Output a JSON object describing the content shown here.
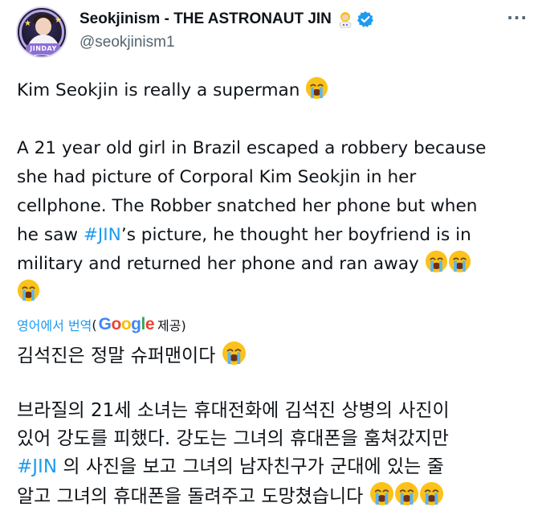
{
  "author": {
    "display_name": "Seokjinism - THE ASTRONAUT JIN",
    "handle": "@seokjinism1",
    "avatar_badge_text": "JINDAY",
    "emoji_after_name": "astronaut-emoji",
    "verified_icon": "verified-badge-icon",
    "verified_color": "#1d9bf0"
  },
  "more_menu_glyph": "···",
  "tweet": {
    "line1": "Kim Seokjin is really a superman",
    "para2_l1": "A 21 year old girl in Brazil escaped a robbery because",
    "para2_l2": "she had picture of Corporal Kim Seokjin in her",
    "para2_l3": "cellphone. The Robber snatched her phone but when",
    "para2_l4_pre": "he saw ",
    "hashtag": "#JIN",
    "para2_l4_post": "’s picture, he thought her boyfriend is in",
    "para2_l5": "military and returned her phone and ran away",
    "emoji": "loudly-crying-face-emoji"
  },
  "translation": {
    "label": "영어에서 번역",
    "open_paren": "(",
    "google_letters": [
      "G",
      "o",
      "o",
      "g",
      "l",
      "e"
    ],
    "google_colors": [
      "#4285F4",
      "#EA4335",
      "#FBBC05",
      "#4285F4",
      "#34A853",
      "#EA4335"
    ],
    "provided": " 제공)"
  },
  "korean": {
    "line1": "김석진은 정말 슈퍼맨이다",
    "p2_l1": "브라질의 21세 소녀는 휴대전화에 김석진 상병의 사진이",
    "p2_l2": "있어 강도를 피했다. 강도는 그녀의 휴대폰을 훔쳐갔지만",
    "hashtag": "#JIN",
    "p2_l3_post": " 의 사진을 보고 그녀의 남자친구가 군대에 있는 줄",
    "p2_l4": "알고 그녀의 휴대폰을 돌려주고 도망쳤습니다"
  }
}
